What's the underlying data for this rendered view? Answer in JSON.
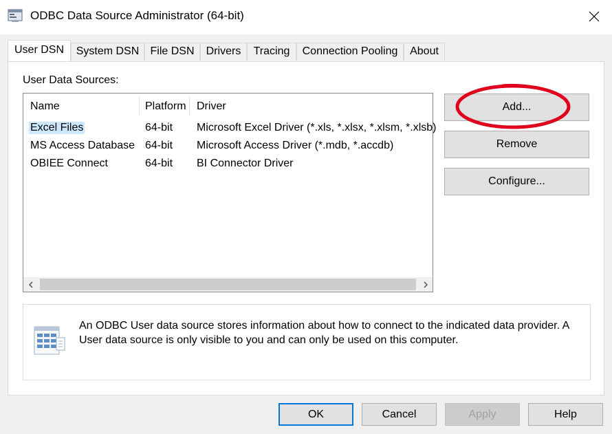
{
  "window": {
    "title": "ODBC Data Source Administrator (64-bit)",
    "icon": "odbc-admin-icon",
    "close_icon": "close-icon"
  },
  "tabs": [
    {
      "label": "User DSN",
      "active": true
    },
    {
      "label": "System DSN"
    },
    {
      "label": "File DSN"
    },
    {
      "label": "Drivers"
    },
    {
      "label": "Tracing"
    },
    {
      "label": "Connection Pooling"
    },
    {
      "label": "About"
    }
  ],
  "user_dsn": {
    "section_label": "User Data Sources:",
    "columns": [
      "Name",
      "Platform",
      "Driver"
    ],
    "rows": [
      {
        "name": "Excel Files",
        "platform": "64-bit",
        "driver": "Microsoft Excel Driver (*.xls, *.xlsx, *.xlsm, *.xlsb)",
        "selected": true
      },
      {
        "name": "MS Access Database",
        "platform": "64-bit",
        "driver": "Microsoft Access Driver (*.mdb, *.accdb)"
      },
      {
        "name": "OBIEE Connect",
        "platform": "64-bit",
        "driver": "BI Connector Driver"
      }
    ],
    "scroll_left_icon": "chevron-left-icon",
    "scroll_right_icon": "chevron-right-icon",
    "buttons": {
      "add": "Add...",
      "remove": "Remove",
      "configure": "Configure..."
    },
    "info_icon": "data-source-icon",
    "info_text": "An ODBC User data source stores information about how to connect to the indicated data provider.   A User data source is only visible to you and can only be used on this computer."
  },
  "footer": {
    "ok": "OK",
    "cancel": "Cancel",
    "apply": "Apply",
    "help": "Help"
  },
  "colors": {
    "selection": "#cce8ff",
    "default_button_border": "#0078d7",
    "highlight_ellipse": "#e0001b"
  }
}
